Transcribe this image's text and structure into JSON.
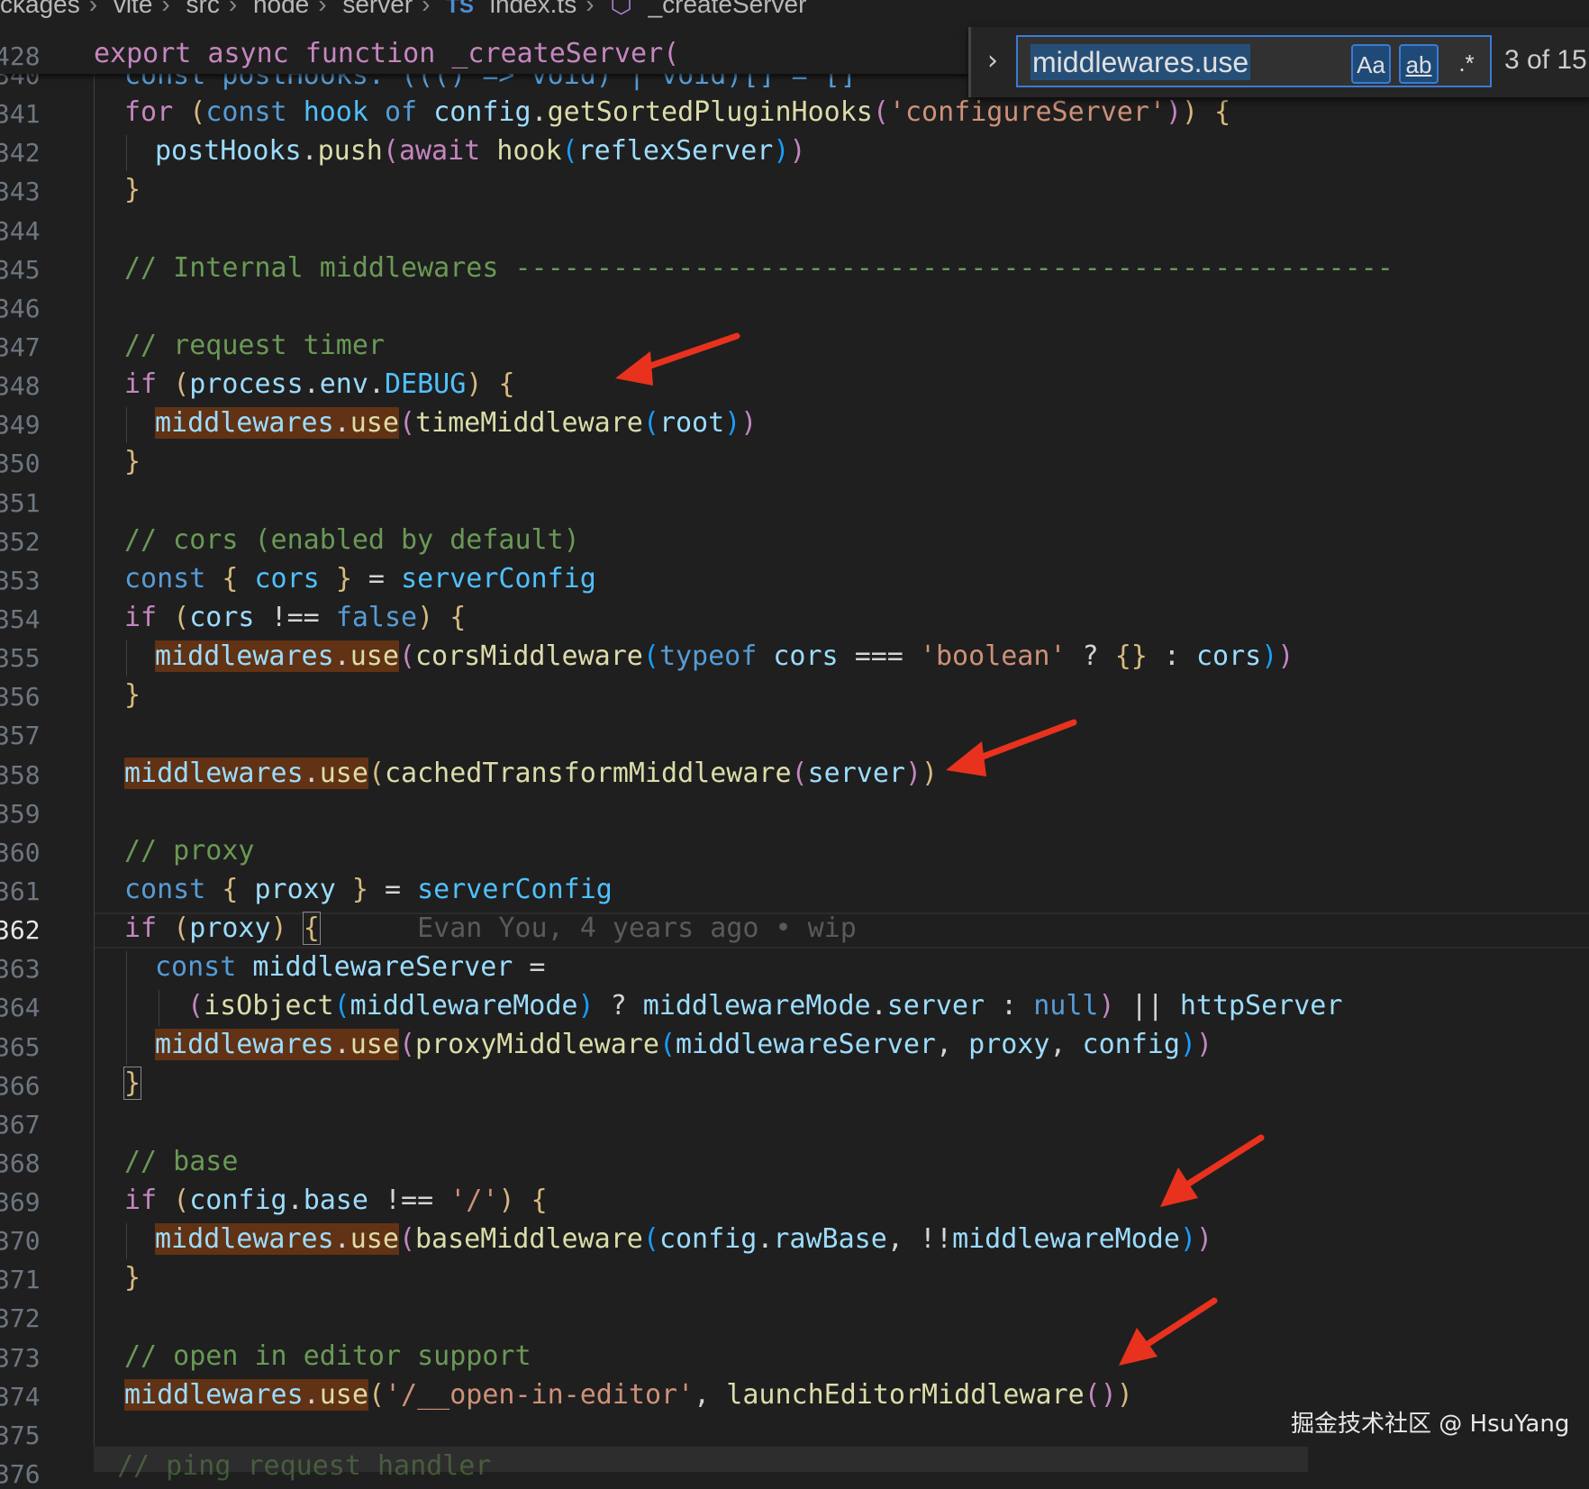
{
  "breadcrumb": [
    "ckages",
    "vite",
    "src",
    "node",
    "server",
    "index.ts",
    "_createServer"
  ],
  "breadcrumb_file_badge": "TS",
  "sticky_header": {
    "line": "428",
    "text": "export async function _createServer("
  },
  "find_widget": {
    "query": "middlewares.use",
    "match_case_label": "Aa",
    "whole_word_label": "ab",
    "regex_label": ".*",
    "match_count": "3 of 15"
  },
  "line_numbers": [
    "340",
    "341",
    "342",
    "343",
    "344",
    "345",
    "346",
    "347",
    "348",
    "349",
    "350",
    "351",
    "352",
    "353",
    "354",
    "355",
    "356",
    "357",
    "358",
    "359",
    "360",
    "361",
    "362",
    "363",
    "364",
    "365",
    "366",
    "367",
    "368",
    "369",
    "370",
    "371",
    "372",
    "373",
    "374",
    "375",
    "376"
  ],
  "active_line": "362",
  "code": {
    "l340": "const postHooks: ((() => void) | void)[] = []",
    "l341_a": "for",
    "l341_b": "const",
    "l341_c": "hook",
    "l341_d": "of",
    "l341_e": "config",
    "l341_f": "getSortedPluginHooks",
    "l341_g": "'configureServer'",
    "l342_a": "postHooks",
    "l342_b": "push",
    "l342_c": "await",
    "l342_d": "hook",
    "l342_e": "reflexServer",
    "l345": "// Internal middlewares ------------------------------------------------------",
    "l347": "// request timer",
    "l348_a": "if",
    "l348_b": "process",
    "l348_c": "env",
    "l348_d": "DEBUG",
    "l349_a": "middlewares",
    "l349_b": "use",
    "l349_c": "timeMiddleware",
    "l349_d": "root",
    "l352": "// cors (enabled by default)",
    "l353_a": "const",
    "l353_b": "cors",
    "l353_c": "serverConfig",
    "l354_a": "if",
    "l354_b": "cors",
    "l354_c": "!==",
    "l354_d": "false",
    "l355_a": "middlewares",
    "l355_b": "use",
    "l355_c": "corsMiddleware",
    "l355_d": "typeof",
    "l355_e": "cors",
    "l355_f": "===",
    "l355_g": "'boolean'",
    "l355_h": "cors",
    "l358_a": "middlewares",
    "l358_b": "use",
    "l358_c": "cachedTransformMiddleware",
    "l358_d": "server",
    "l360": "// proxy",
    "l361_a": "const",
    "l361_b": "proxy",
    "l361_c": "serverConfig",
    "l362_a": "if",
    "l362_b": "proxy",
    "l362_blame": "Evan You, 4 years ago • wip",
    "l363_a": "const",
    "l363_b": "middlewareServer",
    "l364_a": "isObject",
    "l364_b": "middlewareMode",
    "l364_c": "middlewareMode",
    "l364_d": "server",
    "l364_e": "null",
    "l364_f": "httpServer",
    "l365_a": "middlewares",
    "l365_b": "use",
    "l365_c": "proxyMiddleware",
    "l365_d": "middlewareServer",
    "l365_e": "proxy",
    "l365_f": "config",
    "l368": "// base",
    "l369_a": "if",
    "l369_b": "config",
    "l369_c": "base",
    "l369_d": "!==",
    "l369_e": "'/'",
    "l370_a": "middlewares",
    "l370_b": "use",
    "l370_c": "baseMiddleware",
    "l370_d": "config",
    "l370_e": "rawBase",
    "l370_f": "middlewareMode",
    "l373": "// open in editor support",
    "l374_a": "middlewares",
    "l374_b": "use",
    "l374_c": "'/__open-in-editor'",
    "l374_d": "launchEditorMiddleware",
    "l376": "// ping request handler"
  },
  "watermark": "掘金技术社区 @ HsuYang",
  "colors": {
    "background": "#1f1f1f",
    "match_highlight": "#613214",
    "arrow": "#e8321e",
    "find_border": "#3a7bd5"
  },
  "icons": [
    "chevron-right-icon",
    "symbol-method-icon",
    "toggle-replace-icon"
  ]
}
